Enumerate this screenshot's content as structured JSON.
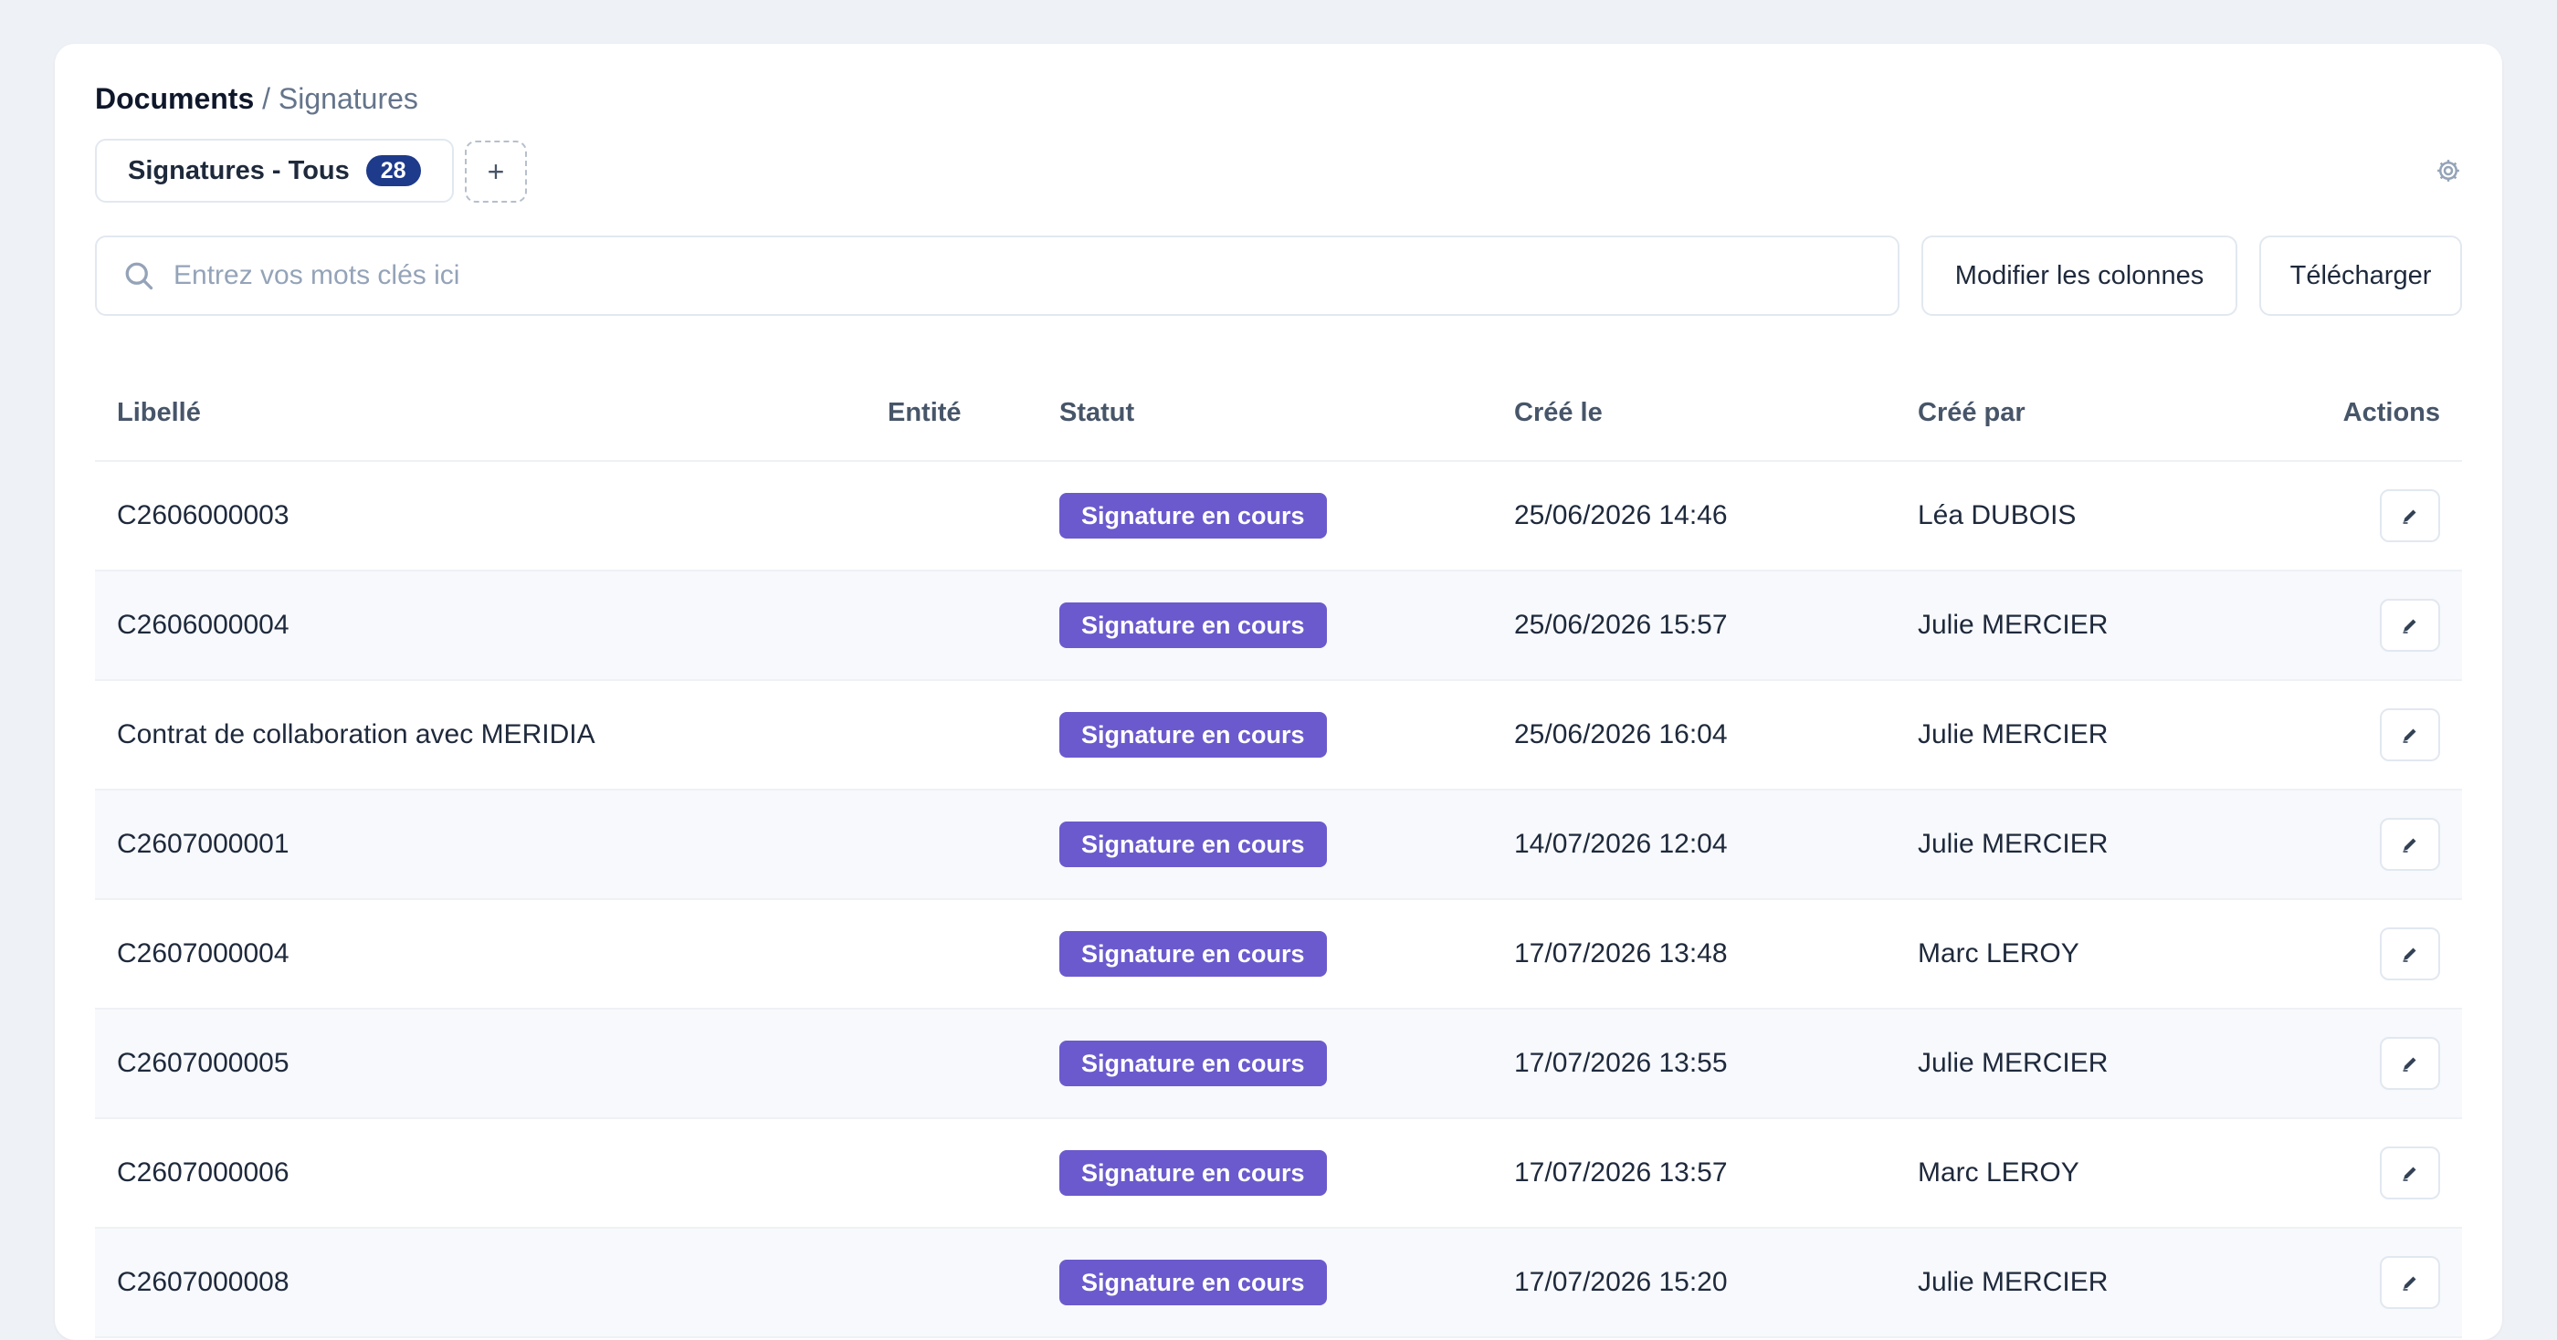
{
  "breadcrumb": {
    "root": "Documents",
    "separator": "/",
    "current": "Signatures"
  },
  "view_tab": {
    "label": "Signatures - Tous",
    "count": "28"
  },
  "add_view_label": "+",
  "search": {
    "placeholder": "Entrez vos mots clés ici",
    "value": ""
  },
  "toolbar": {
    "columns_label": "Modifier les colonnes",
    "download_label": "Télécharger"
  },
  "table": {
    "columns": {
      "label": "Libellé",
      "entity": "Entité",
      "status": "Statut",
      "created_at": "Créé le",
      "created_by": "Créé par",
      "actions": "Actions"
    },
    "rows": [
      {
        "label": "C2606000003",
        "entity": "",
        "status": "Signature en cours",
        "created_at": "25/06/2026 14:46",
        "created_by": "Léa DUBOIS"
      },
      {
        "label": "C2606000004",
        "entity": "",
        "status": "Signature en cours",
        "created_at": "25/06/2026 15:57",
        "created_by": "Julie MERCIER"
      },
      {
        "label": "Contrat de collaboration avec MERIDIA",
        "entity": "",
        "status": "Signature en cours",
        "created_at": "25/06/2026 16:04",
        "created_by": "Julie MERCIER"
      },
      {
        "label": "C2607000001",
        "entity": "",
        "status": "Signature en cours",
        "created_at": "14/07/2026 12:04",
        "created_by": "Julie MERCIER"
      },
      {
        "label": "C2607000004",
        "entity": "",
        "status": "Signature en cours",
        "created_at": "17/07/2026 13:48",
        "created_by": "Marc LEROY"
      },
      {
        "label": "C2607000005",
        "entity": "",
        "status": "Signature en cours",
        "created_at": "17/07/2026 13:55",
        "created_by": "Julie MERCIER"
      },
      {
        "label": "C2607000006",
        "entity": "",
        "status": "Signature en cours",
        "created_at": "17/07/2026 13:57",
        "created_by": "Marc LEROY"
      },
      {
        "label": "C2607000008",
        "entity": "",
        "status": "Signature en cours",
        "created_at": "17/07/2026 15:20",
        "created_by": "Julie MERCIER"
      }
    ]
  },
  "colors": {
    "status_badge": "#6a5acd",
    "count_badge": "#1e3a8a",
    "page_background": "#eef1f6"
  },
  "icons": {
    "search": "search-icon",
    "settings": "gear-icon",
    "edit": "pencil-icon"
  }
}
